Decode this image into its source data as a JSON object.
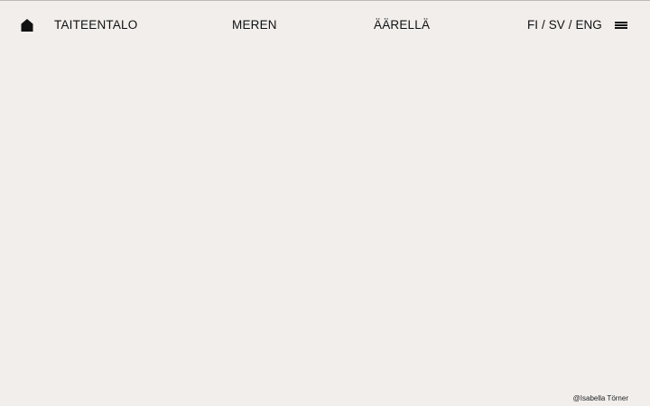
{
  "header": {
    "home_icon": "home-icon",
    "title_words": [
      "TAITEENTALO",
      "MEREN",
      "ÄÄRELLÄ"
    ],
    "languages": [
      "FI",
      "SV",
      "ENG"
    ],
    "language_separator": "/",
    "menu_icon": "hamburger-menu-icon"
  },
  "footer": {
    "credit": "@Isabella Törner"
  },
  "colors": {
    "background": "#f1eeec",
    "text": "#111111"
  }
}
